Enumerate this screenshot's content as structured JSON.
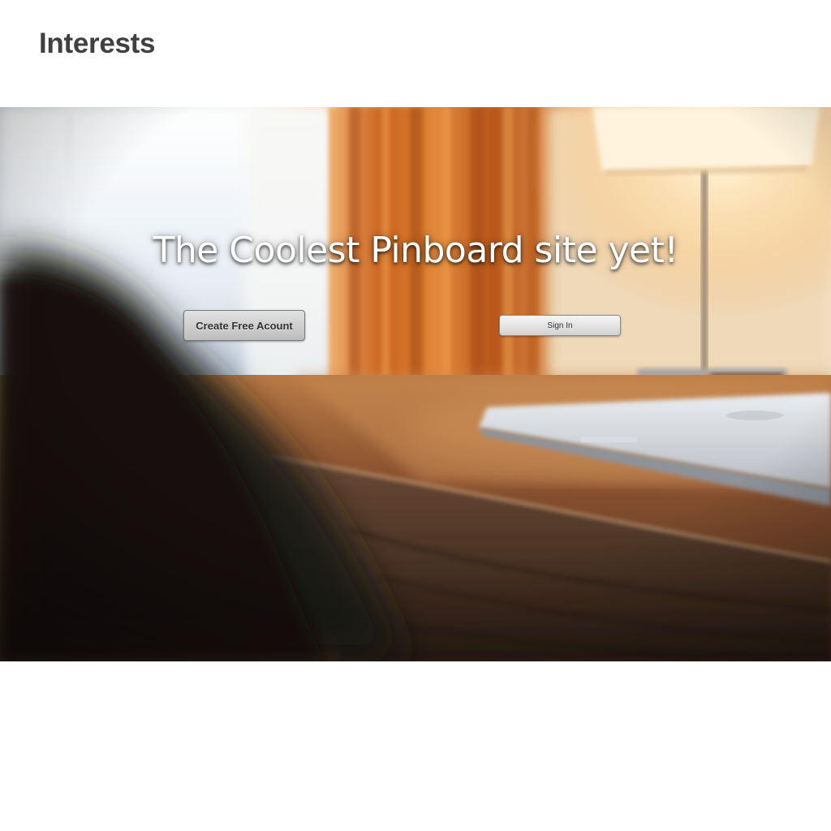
{
  "header": {
    "logo": "Interests"
  },
  "hero": {
    "headline": "The Coolest Pinboard site yet!",
    "create_account_label": "Create Free Acount",
    "sign_in_label": "Sign In"
  }
}
